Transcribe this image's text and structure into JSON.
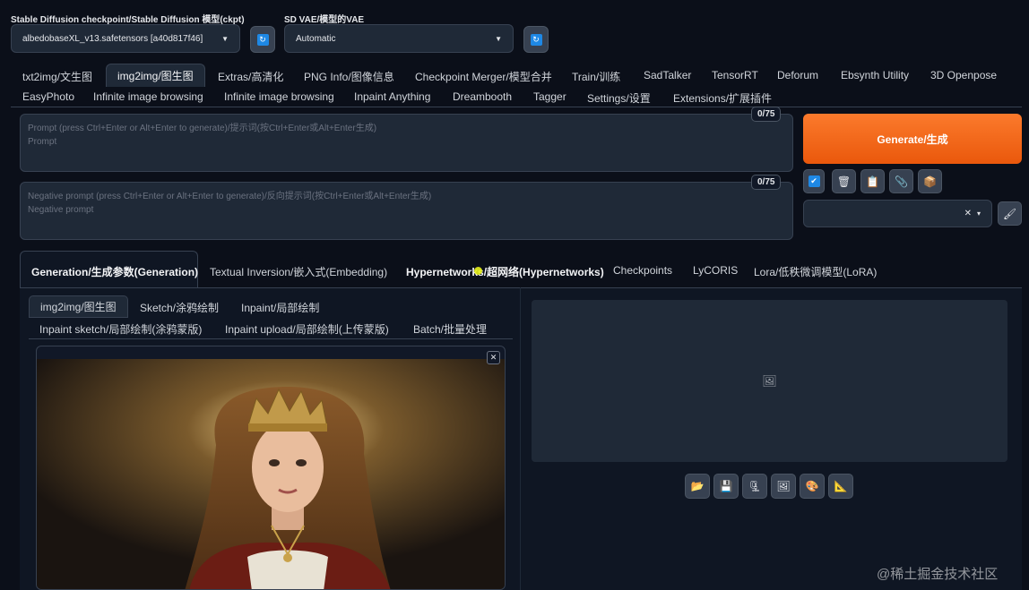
{
  "model": {
    "checkpoint_label": "Stable Diffusion checkpoint/Stable Diffusion 模型(ckpt)",
    "checkpoint_value": "albedobaseXL_v13.safetensors [a40d817f46]",
    "vae_label": "SD VAE/模型的VAE",
    "vae_value": "Automatic",
    "refresh_glyph": "↻"
  },
  "main_tabs": {
    "row1": [
      "txt2img/文生图",
      "img2img/图生图",
      "Extras/高清化",
      "PNG Info/图像信息",
      "Checkpoint Merger/模型合并",
      "Train/训练",
      "SadTalker",
      "TensorRT",
      "Deforum",
      "Ebsynth Utility",
      "3D Openpose"
    ],
    "row2": [
      "EasyPhoto",
      "Infinite image browsing",
      "Infinite image browsing",
      "Inpaint Anything",
      "Dreambooth",
      "Tagger",
      "Settings/设置",
      "Extensions/扩展插件"
    ]
  },
  "prompt": {
    "placeholder_line1": "Prompt (press Ctrl+Enter or Alt+Enter to generate)/提示词(按Ctrl+Enter或Alt+Enter生成)",
    "placeholder_line2": "Prompt",
    "counter": "0/75"
  },
  "negative_prompt": {
    "placeholder_line1": "Negative prompt (press Ctrl+Enter or Alt+Enter to generate)/反向提示词(按Ctrl+Enter或Alt+Enter生成)",
    "placeholder_line2": "Negative prompt",
    "counter": "0/75"
  },
  "generate": {
    "label": "Generate/生成"
  },
  "tools": {
    "check_glyph": "✔",
    "trash_glyph": "🗑",
    "clipboard_glyph": "📋",
    "paperclip_glyph": "📎",
    "box_glyph": "📦",
    "clear_glyph": "✕",
    "caret_glyph": "▾",
    "brush_glyph": "🖌"
  },
  "sub_tabs": [
    "Generation/生成参数(Generation)",
    "Textual Inversion/嵌入式(Embedding)",
    "Hypernetworks/超网络(Hypernetworks)",
    "Checkpoints",
    "LyCORIS",
    "Lora/低秩微调模型(LoRA)"
  ],
  "img_tabs": {
    "row1": [
      "img2img/图生图",
      "Sketch/涂鸦绘制",
      "Inpaint/局部绘制"
    ],
    "row2": [
      "Inpaint sketch/局部绘制(涂鸦蒙版)",
      "Inpaint upload/局部绘制(上传蒙版)",
      "Batch/批量处理"
    ]
  },
  "image": {
    "close_glyph": "✕"
  },
  "output": {
    "placeholder_glyph": "🖼",
    "buttons": [
      "📂",
      "💾",
      "🗜",
      "🖼",
      "🎨",
      "📐"
    ]
  },
  "watermark": "@稀土掘金技术社区",
  "colors": {
    "background": "#0b0f19",
    "accent_orange": "#ea580c",
    "refresh_blue": "#1e88e5"
  }
}
